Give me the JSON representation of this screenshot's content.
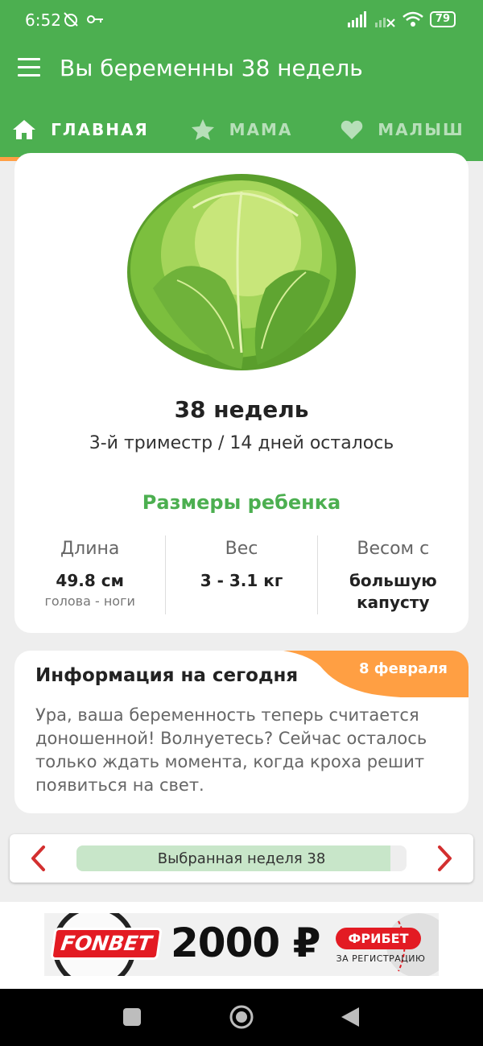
{
  "status_bar": {
    "time": "6:52",
    "battery": "79"
  },
  "app_bar": {
    "title": "Вы беременны 38 недель"
  },
  "tabs": [
    {
      "label": "ГЛАВНАЯ",
      "icon": "home-icon",
      "active": true
    },
    {
      "label": "МАМА",
      "icon": "star-icon",
      "active": false
    },
    {
      "label": "МАЛЫШ",
      "icon": "heart-icon",
      "active": false
    }
  ],
  "colors": {
    "primary": "#4caf50",
    "accent": "#ff9f43",
    "progress": "#c8e6c9",
    "ad_red": "#e31b23"
  },
  "week_card": {
    "image": "cabbage-illustration",
    "title": "38 недель",
    "subtitle": "3-й триместр / 14 дней осталось",
    "sizes_title": "Размеры ребенка",
    "stats": [
      {
        "label": "Длина",
        "value": "49.8 см",
        "note": "голова - ноги"
      },
      {
        "label": "Вес",
        "value": "3 - 3.1 кг",
        "note": ""
      },
      {
        "label": "Весом с",
        "value": "большую капусту",
        "note": ""
      }
    ]
  },
  "info_card": {
    "title": "Информация на сегодня",
    "date": "8 февраля",
    "text": "Ура, ваша беременность теперь считается доношенной! Волнуетесь? Сейчас осталось только ждать момента, когда кроха решит появиться на свет."
  },
  "week_nav": {
    "label": "Выбранная неделя 38",
    "progress_fraction": 0.95
  },
  "ad": {
    "brand": "FONBET",
    "amount": "2000 ₽",
    "badge": "ФРИБЕТ",
    "caption": "ЗА РЕГИСТРАЦИЮ"
  }
}
